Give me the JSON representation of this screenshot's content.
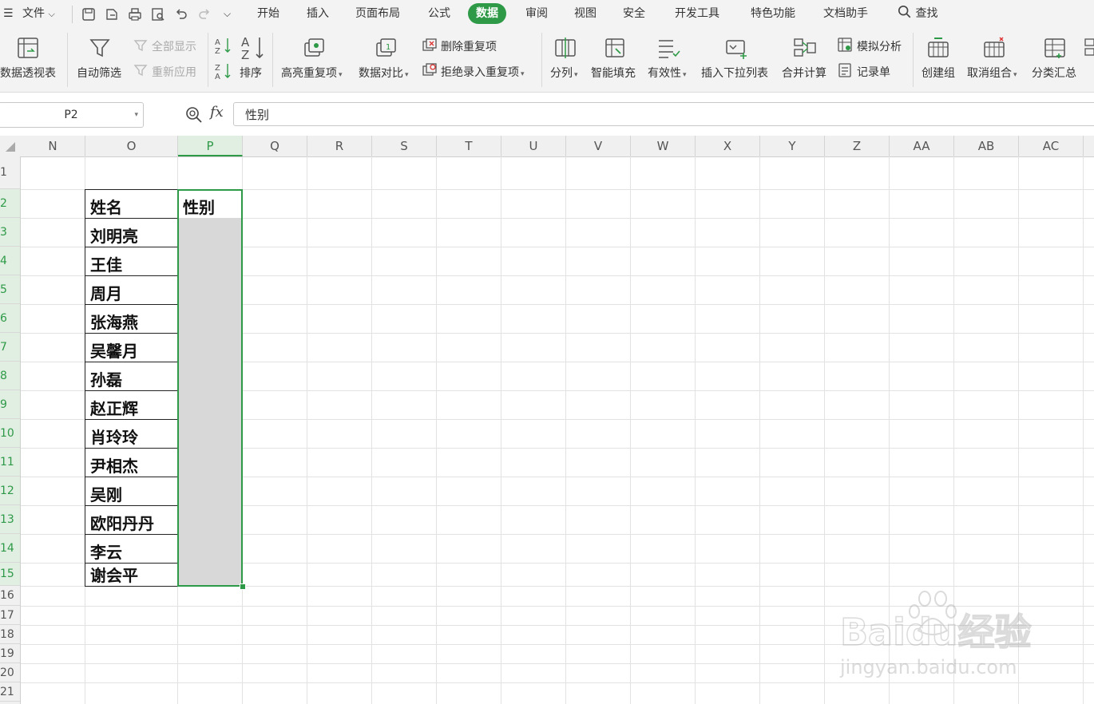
{
  "menubar": {
    "file": "文件",
    "tabs": [
      "开始",
      "插入",
      "页面布局",
      "公式",
      "数据",
      "审阅",
      "视图",
      "安全",
      "开发工具",
      "特色功能",
      "文档助手"
    ],
    "active_tab": "数据",
    "search": "查找"
  },
  "ribbon": {
    "pivot": "数据透视表",
    "autofilter": "自动筛选",
    "show_all": "全部显示",
    "reapply": "重新应用",
    "sort": "排序",
    "highlight_dup": "高亮重复项",
    "compare": "数据对比",
    "delete_dup": "删除重复项",
    "reject_dup": "拒绝录入重复项",
    "split": "分列",
    "smart_fill": "智能填充",
    "validity": "有效性",
    "insert_dropdown": "插入下拉列表",
    "consolidate": "合并计算",
    "simulate": "模拟分析",
    "record": "记录单",
    "group": "创建组",
    "ungroup": "取消组合",
    "subtotal": "分类汇总"
  },
  "formula_bar": {
    "name_box": "P2",
    "fx": "fx",
    "content": "性别"
  },
  "columns": [
    "N",
    "O",
    "P",
    "Q",
    "R",
    "S",
    "T",
    "U",
    "V",
    "W",
    "X",
    "Y",
    "Z",
    "AA",
    "AB",
    "AC"
  ],
  "selected_column": "P",
  "rows": [
    "1",
    "2",
    "3",
    "4",
    "5",
    "6",
    "7",
    "8",
    "9",
    "10",
    "11",
    "12",
    "13",
    "14",
    "15",
    "16",
    "17",
    "18",
    "19",
    "20",
    "21"
  ],
  "table": {
    "header_name": "姓名",
    "header_gender": "性别",
    "names": [
      "刘明亮",
      "王佳",
      "周月",
      "张海燕",
      "吴馨月",
      "孙磊",
      "赵正辉",
      "肖玲玲",
      "尹相杰",
      "吴刚",
      "欧阳丹丹",
      "李云",
      "谢会平"
    ]
  },
  "watermark": {
    "brand": "Baidu经验",
    "url": "jingyan.baidu.com"
  },
  "colors": {
    "accent": "#2e9a47",
    "selection_fill": "#d8d8d8"
  }
}
